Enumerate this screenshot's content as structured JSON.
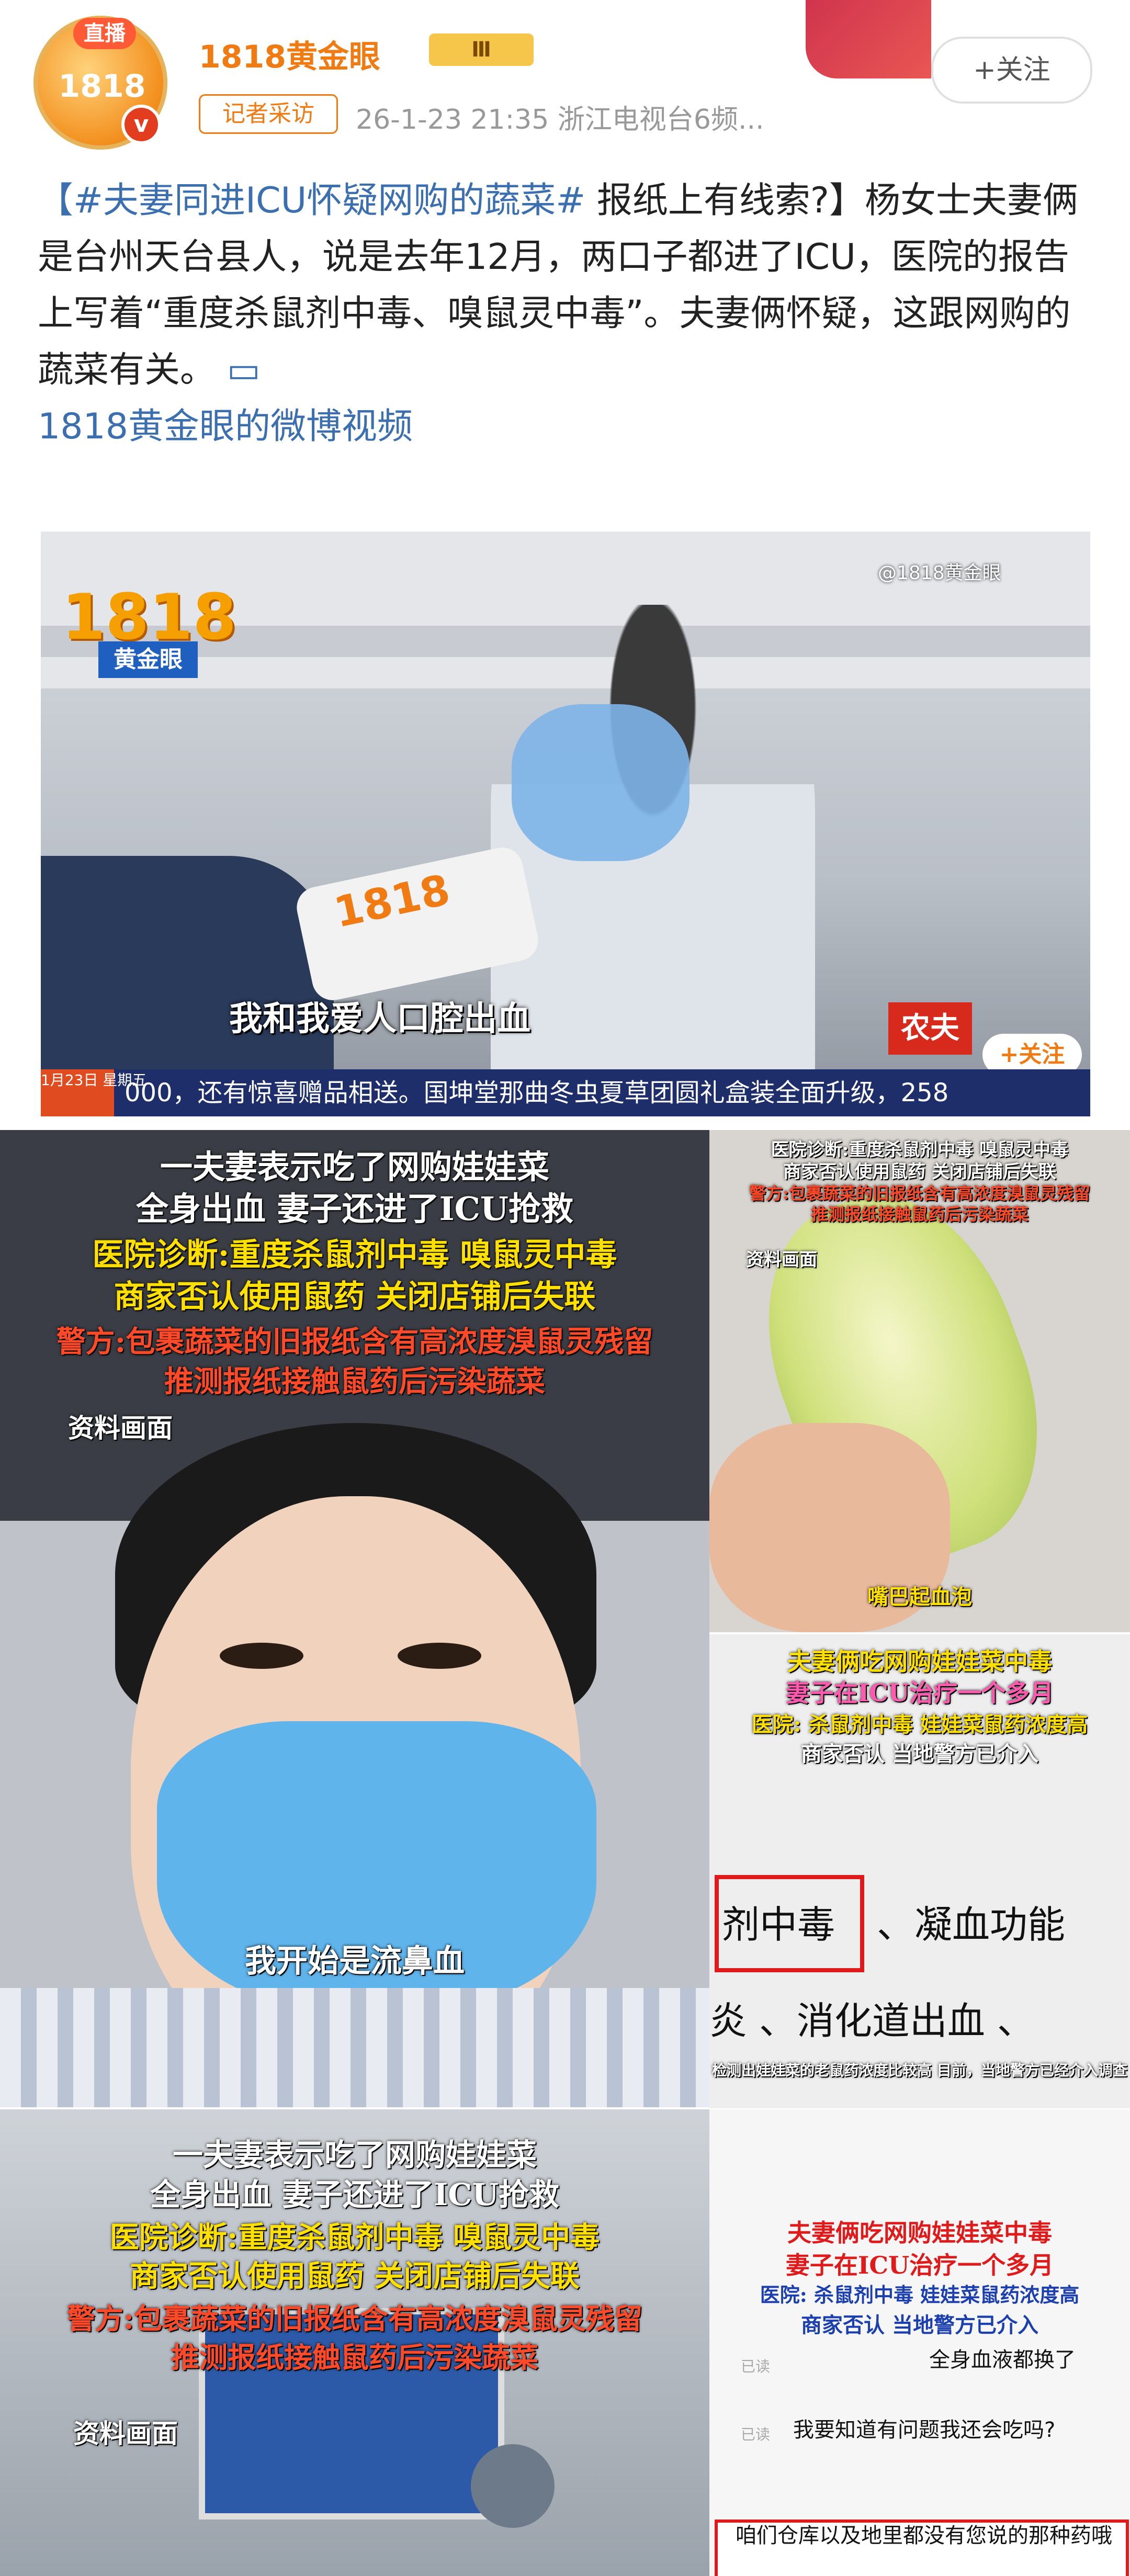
{
  "header": {
    "live_badge": "直播",
    "avatar_logo": "1818",
    "verify_mark": "v",
    "username": "1818黄金眼",
    "rank": "Ⅲ",
    "reporter_tag": "记者采访",
    "meta": "26-1-23 21:35  浙江电视台6频...",
    "follow_label": "+关注"
  },
  "post": {
    "topic": "【#夫妻同进ICU怀疑网购的蔬菜#",
    "text": " 报纸上有线索?】杨女士夫妻俩是台州天台县人，说是去年12月，两口子都进了ICU，医院的报告上写着“重度杀鼠剂中毒、嗅鼠灵中毒”。夫妻俩怀疑，这跟网购的蔬菜有关。",
    "video_icon": "▭",
    "link": "1818黄金眼的微博视频"
  },
  "video": {
    "logo_num": "1818",
    "logo_name": "黄金眼",
    "watermark": "@1818黄金眼",
    "subtitle": "我和我爱人口腔出血",
    "mic_logo": "1818",
    "ticker_date": "1月23日 星期五",
    "ticker": "000，还有惊喜赠品相送。国坤堂那曲冬虫夏草团圆礼盒装全面升级，258",
    "corner_tag": "农夫",
    "corner_follow": "+关注"
  },
  "panel1": {
    "line1": "一夫妻表示吃了网购娃娃菜",
    "line2": "全身出血 妻子还进了ICU抢救",
    "line3": "医院诊断:重度杀鼠剂中毒 嗅鼠灵中毒",
    "line4": "商家否认使用鼠药 关闭店铺后失联",
    "line5": "警方:包裹蔬菜的旧报纸含有高浓度溴鼠灵残留",
    "line6": "推测报纸接触鼠药后污染蔬菜",
    "label": "资料画面",
    "subtitle": "我开始是流鼻血"
  },
  "panel2": {
    "line1": "医院诊断:重度杀鼠剂中毒 嗅鼠灵中毒",
    "line2": "商家否认使用鼠药 关闭店铺后失联",
    "line3": "警方:包裹蔬菜的旧报纸含有高浓度溴鼠灵残留",
    "line4": "推测报纸接触鼠药后污染蔬菜",
    "label": "资料画面",
    "caption": "嘴巴起血泡"
  },
  "panel3": {
    "line1": "夫妻俩吃网购娃娃菜中毒",
    "line2": "妻子在ICU治疗一个多月",
    "line3": "医院: 杀鼠剂中毒 娃娃菜鼠药浓度高",
    "line4": "商家否认 当地警方已介入",
    "doc_text1": "剂中毒",
    "doc_text2": "、凝血功能",
    "doc_text3": "炎 、消化道出血 、",
    "foot": "检测出娃娃菜的老鼠药浓度比较高 目前，当地警方已经介入调查"
  },
  "panel4": {
    "line1": "一夫妻表示吃了网购娃娃菜",
    "line2": "全身出血 妻子还进了ICU抢救",
    "line3": "医院诊断:重度杀鼠剂中毒 嗅鼠灵中毒",
    "line4": "商家否认使用鼠药 关闭店铺后失联",
    "line5": "警方:包裹蔬菜的旧报纸含有高浓度溴鼠灵残留",
    "line6": "推测报纸接触鼠药后污染蔬菜",
    "label": "资料画面"
  },
  "panel5": {
    "line1": "夫妻俩吃网购娃娃菜中毒",
    "line2": "妻子在ICU治疗一个多月",
    "line3": "医院: 杀鼠剂中毒 娃娃菜鼠药浓度高",
    "line4": "商家否认 当地警方已介入",
    "chat1": "全身血液都换了",
    "chat2": "我要知道有问题我还会吃吗?",
    "chat3": "咱们仓库以及地里都没有您说的那种药哦",
    "small1": "已读",
    "small2": "已读"
  }
}
